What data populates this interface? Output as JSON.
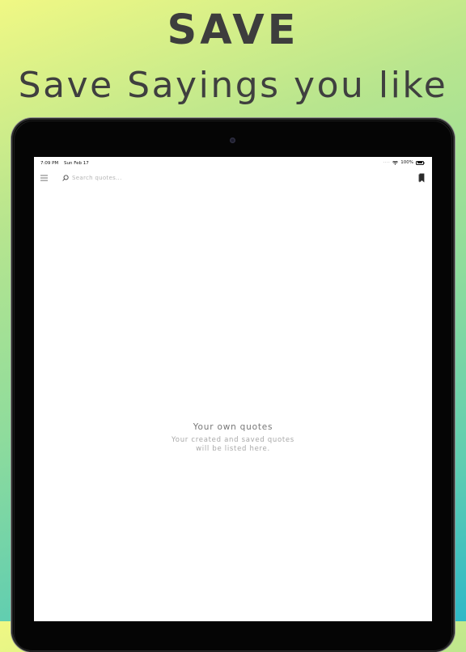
{
  "promo": {
    "headline": "SAVE",
    "subheadline": "Save Sayings you like"
  },
  "status_bar": {
    "time": "7:09 PM",
    "date": "Sun Feb 17",
    "battery": "100%"
  },
  "toolbar": {
    "search_placeholder": "Search quotes...",
    "menu_icon": "hamburger-menu-icon",
    "search_icon": "magnifier-icon",
    "bookmark_icon": "bookmark-icon"
  },
  "empty_state": {
    "title": "Your own quotes",
    "description_line1": "Your created and saved quotes",
    "description_line2": "will be listed here."
  },
  "colors": {
    "gradient_top": "#f0f884",
    "gradient_bottom": "#2fb8c7",
    "headline_text": "#3d3d3d",
    "device_frame": "#050505",
    "screen_bg": "#ffffff"
  }
}
